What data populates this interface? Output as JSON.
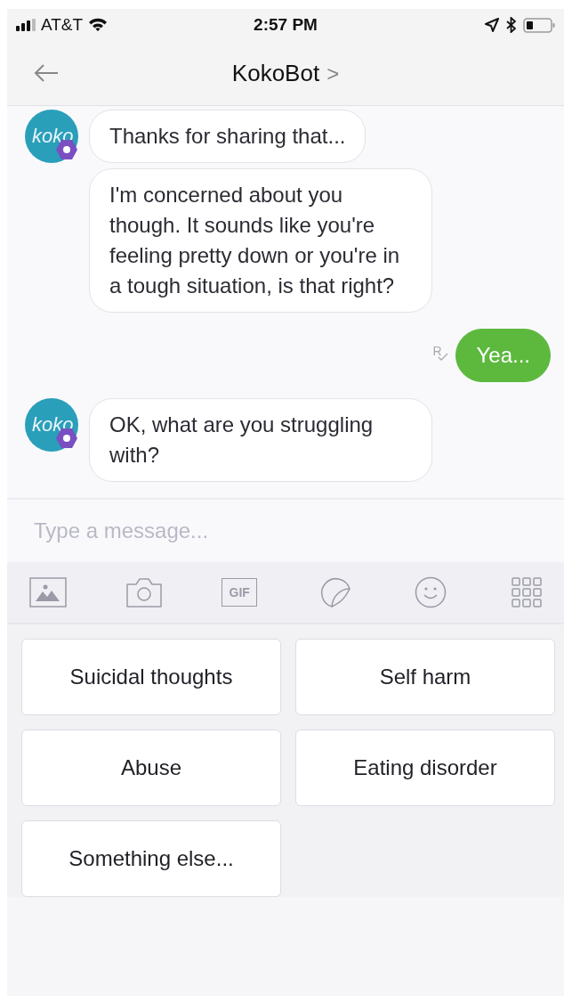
{
  "status_bar": {
    "carrier": "AT&T",
    "time": "2:57 PM"
  },
  "nav": {
    "title": "KokoBot",
    "chevron": ">"
  },
  "messages": [
    {
      "kind": "bot",
      "logo_text": "koko",
      "bubbles": [
        "Thanks for sharing that...",
        "I'm concerned about you though. It sounds like you're feeling pretty down or you're in a tough situation, is that right?"
      ]
    },
    {
      "kind": "user",
      "read_mark": "R",
      "bubbles": [
        "Yea..."
      ]
    },
    {
      "kind": "bot",
      "logo_text": "koko",
      "bubbles": [
        "OK, what are you struggling with?"
      ]
    }
  ],
  "composer": {
    "placeholder": "Type a message..."
  },
  "toolbar": [
    {
      "kind": "image"
    },
    {
      "kind": "camera"
    },
    {
      "kind": "gif",
      "label": "GIF"
    },
    {
      "kind": "sticker"
    },
    {
      "kind": "emoji"
    },
    {
      "kind": "apps"
    }
  ],
  "quick_replies": [
    "Suicidal thoughts",
    "Self harm",
    "Abuse",
    "Eating disorder",
    "Something else..."
  ]
}
